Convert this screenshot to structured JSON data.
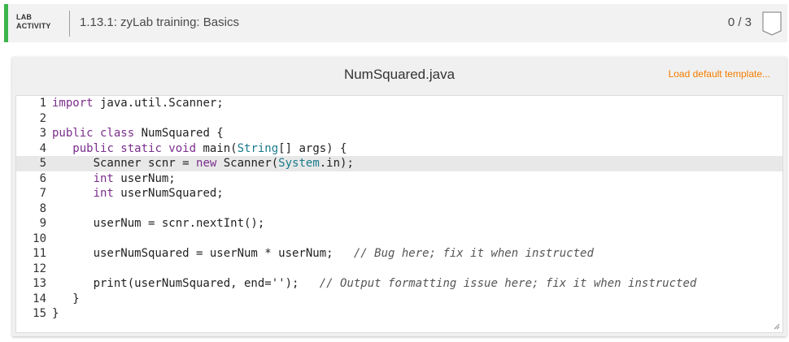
{
  "lab": {
    "tag_line1": "LAB",
    "tag_line2": "ACTIVITY",
    "title": "1.13.1: zyLab training: Basics",
    "score": "0 / 3",
    "accent_color": "#3cb54a"
  },
  "editor": {
    "file_name": "NumSquared.java",
    "load_template_label": "Load default template...",
    "active_line": 5,
    "lines": [
      {
        "no": "1",
        "tokens": [
          {
            "t": "import",
            "c": "kw"
          },
          {
            "t": " java.util.Scanner;",
            "c": ""
          }
        ]
      },
      {
        "no": "2",
        "tokens": []
      },
      {
        "no": "3",
        "tokens": [
          {
            "t": "public class",
            "c": "kw"
          },
          {
            "t": " NumSquared {",
            "c": ""
          }
        ]
      },
      {
        "no": "4",
        "tokens": [
          {
            "t": "   ",
            "c": ""
          },
          {
            "t": "public static void",
            "c": "kw"
          },
          {
            "t": " main(",
            "c": ""
          },
          {
            "t": "String",
            "c": "type"
          },
          {
            "t": "[] args) {",
            "c": ""
          }
        ]
      },
      {
        "no": "5",
        "tokens": [
          {
            "t": "      Scanner scnr = ",
            "c": ""
          },
          {
            "t": "new",
            "c": "kw"
          },
          {
            "t": " Scanner(",
            "c": ""
          },
          {
            "t": "System",
            "c": "type"
          },
          {
            "t": ".in);",
            "c": ""
          }
        ]
      },
      {
        "no": "6",
        "tokens": [
          {
            "t": "      ",
            "c": ""
          },
          {
            "t": "int",
            "c": "kw"
          },
          {
            "t": " userNum;",
            "c": ""
          }
        ]
      },
      {
        "no": "7",
        "tokens": [
          {
            "t": "      ",
            "c": ""
          },
          {
            "t": "int",
            "c": "kw"
          },
          {
            "t": " userNumSquared;",
            "c": ""
          }
        ]
      },
      {
        "no": "8",
        "tokens": []
      },
      {
        "no": "9",
        "tokens": [
          {
            "t": "      userNum = scnr.nextInt();",
            "c": ""
          }
        ]
      },
      {
        "no": "10",
        "tokens": []
      },
      {
        "no": "11",
        "tokens": [
          {
            "t": "      userNumSquared = userNum * userNum;   ",
            "c": ""
          },
          {
            "t": "// Bug here; fix it when instructed",
            "c": "cm"
          }
        ]
      },
      {
        "no": "12",
        "tokens": []
      },
      {
        "no": "13",
        "tokens": [
          {
            "t": "      print(userNumSquared, end='');   ",
            "c": ""
          },
          {
            "t": "// Output formatting issue here; fix it when instructed",
            "c": "cm"
          }
        ]
      },
      {
        "no": "14",
        "tokens": [
          {
            "t": "   }",
            "c": ""
          }
        ]
      },
      {
        "no": "15",
        "tokens": [
          {
            "t": "}",
            "c": ""
          }
        ]
      }
    ]
  }
}
